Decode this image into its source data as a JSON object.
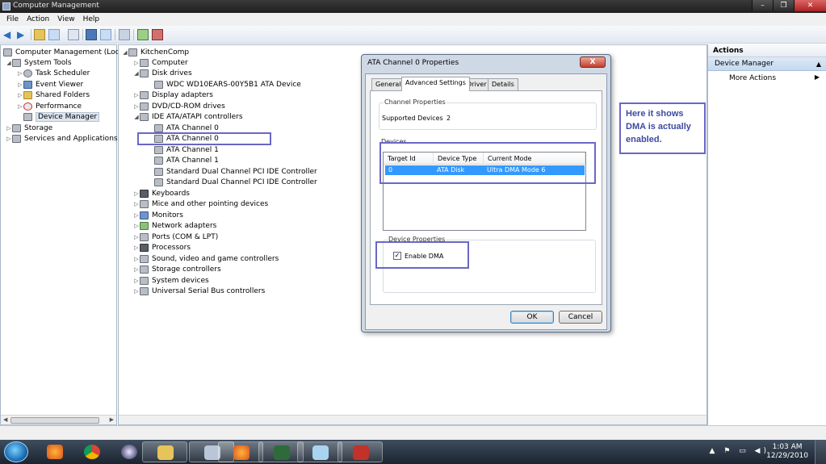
{
  "window": {
    "title": "Computer Management",
    "controls": [
      "–",
      "❐",
      "✕"
    ]
  },
  "menu": [
    "File",
    "Action",
    "View",
    "Help"
  ],
  "left_tree": {
    "root": "Computer Management (Local",
    "items": [
      {
        "label": "System Tools",
        "expanded": true
      },
      {
        "label": "Task Scheduler"
      },
      {
        "label": "Event Viewer"
      },
      {
        "label": "Shared Folders"
      },
      {
        "label": "Performance"
      },
      {
        "label": "Device Manager",
        "selected": true
      },
      {
        "label": "Storage"
      },
      {
        "label": "Services and Applications"
      }
    ]
  },
  "device_tree": {
    "computer": "KitchenComp",
    "items": [
      {
        "label": "Computer",
        "level": 1
      },
      {
        "label": "Disk drives",
        "level": 1,
        "expanded": true
      },
      {
        "label": "WDC WD10EARS-00Y5B1 ATA Device",
        "level": 2
      },
      {
        "label": "Display adapters",
        "level": 1
      },
      {
        "label": "DVD/CD-ROM drives",
        "level": 1
      },
      {
        "label": "IDE ATA/ATAPI controllers",
        "level": 1,
        "expanded": true
      },
      {
        "label": "ATA Channel 0",
        "level": 2
      },
      {
        "label": "ATA Channel 0",
        "level": 2,
        "highlighted": true
      },
      {
        "label": "ATA Channel 1",
        "level": 2
      },
      {
        "label": "ATA Channel 1",
        "level": 2
      },
      {
        "label": "Standard Dual Channel PCI IDE Controller",
        "level": 2
      },
      {
        "label": "Standard Dual Channel PCI IDE Controller",
        "level": 2
      },
      {
        "label": "Keyboards",
        "level": 1
      },
      {
        "label": "Mice and other pointing devices",
        "level": 1
      },
      {
        "label": "Monitors",
        "level": 1
      },
      {
        "label": "Network adapters",
        "level": 1
      },
      {
        "label": "Ports (COM & LPT)",
        "level": 1
      },
      {
        "label": "Processors",
        "level": 1
      },
      {
        "label": "Sound, video and game controllers",
        "level": 1
      },
      {
        "label": "Storage controllers",
        "level": 1
      },
      {
        "label": "System devices",
        "level": 1
      },
      {
        "label": "Universal Serial Bus controllers",
        "level": 1
      }
    ]
  },
  "actions": {
    "header": "Actions",
    "section": "Device Manager",
    "more": "More Actions"
  },
  "dialog": {
    "title": "ATA Channel 0 Properties",
    "close": "X",
    "tabs": [
      "General",
      "Advanced Settings",
      "Driver",
      "Details"
    ],
    "active_tab": "Advanced Settings",
    "channel_properties": {
      "label": "Channel Properties",
      "supported_devices_label": "Supported Devices",
      "supported_devices_value": "2"
    },
    "devices": {
      "label": "Devices",
      "columns": [
        "Target Id",
        "Device Type",
        "Current Mode"
      ],
      "rows": [
        {
          "target_id": "0",
          "device_type": "ATA Disk",
          "current_mode": "Ultra DMA Mode 6"
        }
      ]
    },
    "device_properties": {
      "label": "Device Properties",
      "enable_dma_label": "Enable DMA",
      "enable_dma_checked": true
    },
    "ok": "OK",
    "cancel": "Cancel"
  },
  "annotation": {
    "text": "Here it shows DMA is actually enabled.",
    "color": "#6a67c6"
  },
  "clock": {
    "time": "1:03 AM",
    "date": "12/29/2010"
  },
  "tray_icons": "▲ ⚑ ▭ ◀)",
  "accent": "#3399ff"
}
